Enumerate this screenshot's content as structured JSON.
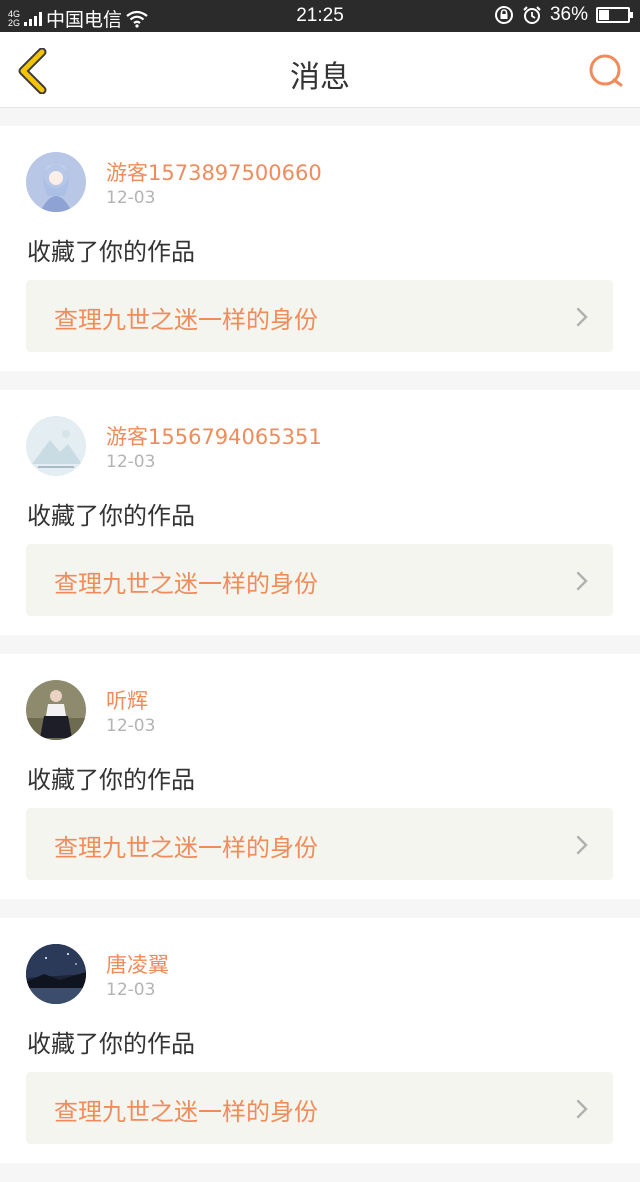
{
  "status_bar": {
    "network_top": "4G",
    "network_bottom": "2G",
    "carrier": "中国电信",
    "time": "21:25",
    "battery_percent_text": "36%",
    "battery_level": 0.36
  },
  "header": {
    "title": "消息",
    "back_icon": "chevron-left-icon",
    "search_icon": "search-icon"
  },
  "colors": {
    "accent": "#ef8c5c",
    "back_arrow": "#f5c400"
  },
  "messages": [
    {
      "user": "游客1573897500660",
      "date": "12-03",
      "action": "收藏了你的作品",
      "work_title": "查理九世之迷一样的身份",
      "avatar": "anime-girl-avatar"
    },
    {
      "user": "游客1556794065351",
      "date": "12-03",
      "action": "收藏了你的作品",
      "work_title": "查理九世之迷一样的身份",
      "avatar": "mountain-placeholder-avatar"
    },
    {
      "user": "听辉",
      "date": "12-03",
      "action": "收藏了你的作品",
      "work_title": "查理九世之迷一样的身份",
      "avatar": "person-photo-avatar"
    },
    {
      "user": "唐凌翼",
      "date": "12-03",
      "action": "收藏了你的作品",
      "work_title": "查理九世之迷一样的身份",
      "avatar": "night-sky-avatar"
    }
  ]
}
